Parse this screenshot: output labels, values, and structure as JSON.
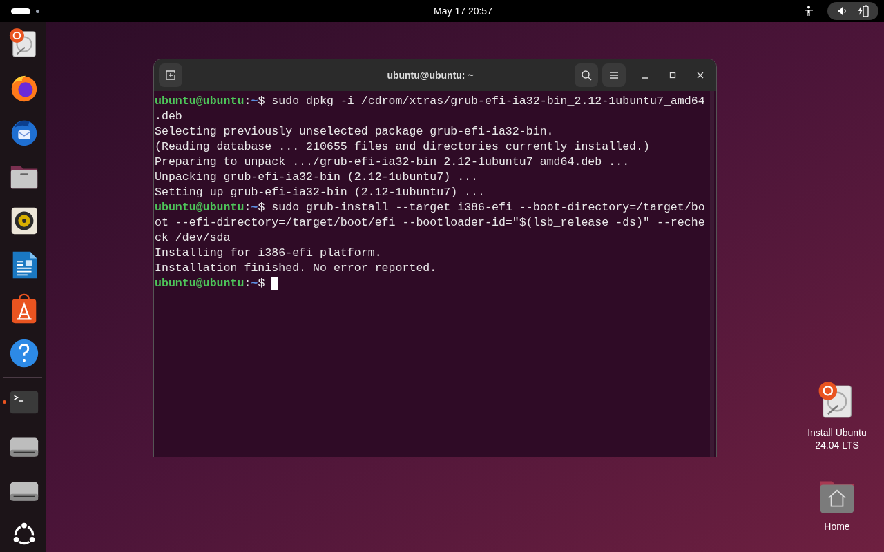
{
  "top_bar": {
    "clock": "May 17  20:57"
  },
  "dock": {
    "items": [
      {
        "kind": "installer",
        "running": false
      },
      {
        "kind": "browser",
        "running": false
      },
      {
        "kind": "mail",
        "running": false
      },
      {
        "kind": "files",
        "running": false
      },
      {
        "kind": "music",
        "running": false
      },
      {
        "kind": "writer",
        "running": false
      },
      {
        "kind": "store",
        "running": false
      },
      {
        "kind": "help",
        "running": false
      },
      {
        "kind": "terminal",
        "running": true
      },
      {
        "kind": "drive",
        "running": false
      },
      {
        "kind": "drive",
        "running": false
      },
      {
        "kind": "apps",
        "running": false
      }
    ]
  },
  "terminal": {
    "title": "ubuntu@ubuntu: ~",
    "cursor": true,
    "lines": [
      {
        "kind": "prompt",
        "user": "ubuntu@ubuntu",
        "colon": ":",
        "path": "~",
        "dollar": "$",
        "command": " sudo dpkg -i /cdrom/xtras/grub-efi-ia32-bin_2.12-1ubuntu7_amd64"
      },
      {
        "kind": "output",
        "text": ".deb"
      },
      {
        "kind": "output",
        "text": "Selecting previously unselected package grub-efi-ia32-bin."
      },
      {
        "kind": "output",
        "text": "(Reading database ... 210655 files and directories currently installed.)"
      },
      {
        "kind": "output",
        "text": "Preparing to unpack .../grub-efi-ia32-bin_2.12-1ubuntu7_amd64.deb ..."
      },
      {
        "kind": "output",
        "text": "Unpacking grub-efi-ia32-bin (2.12-1ubuntu7) ..."
      },
      {
        "kind": "output",
        "text": "Setting up grub-efi-ia32-bin (2.12-1ubuntu7) ..."
      },
      {
        "kind": "prompt",
        "user": "ubuntu@ubuntu",
        "colon": ":",
        "path": "~",
        "dollar": "$",
        "command": " sudo grub-install --target i386-efi --boot-directory=/target/bo"
      },
      {
        "kind": "output",
        "text": "ot --efi-directory=/target/boot/efi --bootloader-id=\"$(lsb_release -ds)\" --reche"
      },
      {
        "kind": "output",
        "text": "ck /dev/sda"
      },
      {
        "kind": "output",
        "text": "Installing for i386-efi platform."
      },
      {
        "kind": "output",
        "text": "Installation finished. No error reported."
      },
      {
        "kind": "prompt",
        "user": "ubuntu@ubuntu",
        "colon": ":",
        "path": "~",
        "dollar": "$"
      }
    ]
  },
  "desktop_icons": [
    {
      "kind": "installer",
      "label": "Install Ubuntu\n24.04 LTS"
    },
    {
      "kind": "home",
      "label": "Home"
    }
  ]
}
